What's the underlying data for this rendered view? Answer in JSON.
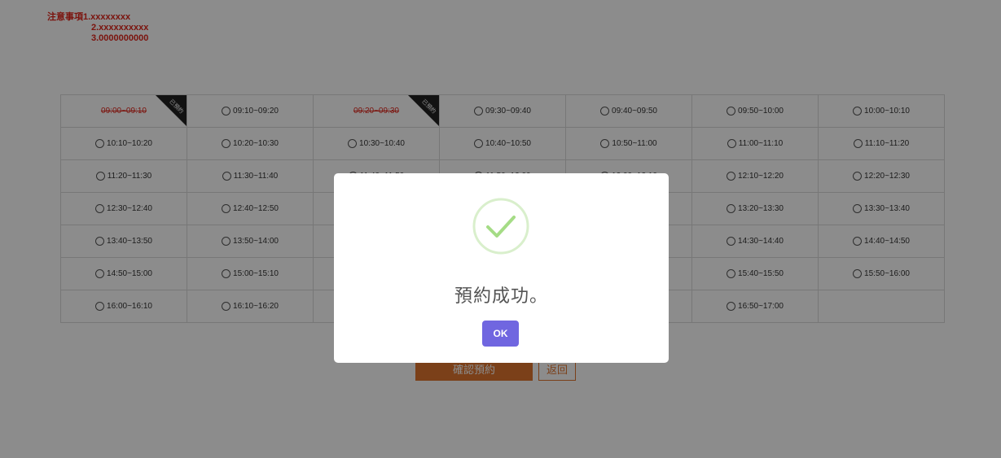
{
  "notes": {
    "line1": "注意事項1.xxxxxxxx",
    "line2": "2.xxxxxxxxxx",
    "line3": "3.0000000000"
  },
  "slots": [
    [
      {
        "time": "09:00~09:10",
        "booked": true,
        "badge": "已預約"
      },
      {
        "time": "09:10~09:20",
        "booked": false
      },
      {
        "time": "09:20~09:30",
        "booked": true,
        "badge": "已預約"
      },
      {
        "time": "09:30~09:40",
        "booked": false
      },
      {
        "time": "09:40~09:50",
        "booked": false
      },
      {
        "time": "09:50~10:00",
        "booked": false
      },
      {
        "time": "10:00~10:10",
        "booked": false
      }
    ],
    [
      {
        "time": "10:10~10:20",
        "booked": false
      },
      {
        "time": "10:20~10:30",
        "booked": false
      },
      {
        "time": "10:30~10:40",
        "booked": false
      },
      {
        "time": "10:40~10:50",
        "booked": false
      },
      {
        "time": "10:50~11:00",
        "booked": false
      },
      {
        "time": "11:00~11:10",
        "booked": false
      },
      {
        "time": "11:10~11:20",
        "booked": false
      }
    ],
    [
      {
        "time": "11:20~11:30",
        "booked": false
      },
      {
        "time": "11:30~11:40",
        "booked": false
      },
      {
        "time": "11:40~11:50",
        "booked": false
      },
      {
        "time": "11:50~12:00",
        "booked": false
      },
      {
        "time": "12:00~12:10",
        "booked": false
      },
      {
        "time": "12:10~12:20",
        "booked": false
      },
      {
        "time": "12:20~12:30",
        "booked": false
      }
    ],
    [
      {
        "time": "12:30~12:40",
        "booked": false
      },
      {
        "time": "12:40~12:50",
        "booked": false
      },
      null,
      null,
      null,
      {
        "time": "13:20~13:30",
        "booked": false
      },
      {
        "time": "13:30~13:40",
        "booked": false
      }
    ],
    [
      {
        "time": "13:40~13:50",
        "booked": false
      },
      {
        "time": "13:50~14:00",
        "booked": false
      },
      null,
      null,
      null,
      {
        "time": "14:30~14:40",
        "booked": false
      },
      {
        "time": "14:40~14:50",
        "booked": false
      }
    ],
    [
      {
        "time": "14:50~15:00",
        "booked": false
      },
      {
        "time": "15:00~15:10",
        "booked": false
      },
      null,
      null,
      null,
      {
        "time": "15:40~15:50",
        "booked": false
      },
      {
        "time": "15:50~16:00",
        "booked": false
      }
    ],
    [
      {
        "time": "16:00~16:10",
        "booked": false
      },
      {
        "time": "16:10~16:20",
        "booked": false
      },
      null,
      null,
      null,
      {
        "time": "16:50~17:00",
        "booked": false
      },
      {
        "time": "",
        "booked": false,
        "empty": true
      }
    ]
  ],
  "buttons": {
    "confirm": "確認預約",
    "back": "返回"
  },
  "modal": {
    "icon": "success-check-icon",
    "title": "預約成功。",
    "ok": "OK"
  },
  "colors": {
    "accent": "#e0752f",
    "notes": "#e1251b",
    "ok_button": "#7066e0",
    "success": "#a5dc86"
  }
}
